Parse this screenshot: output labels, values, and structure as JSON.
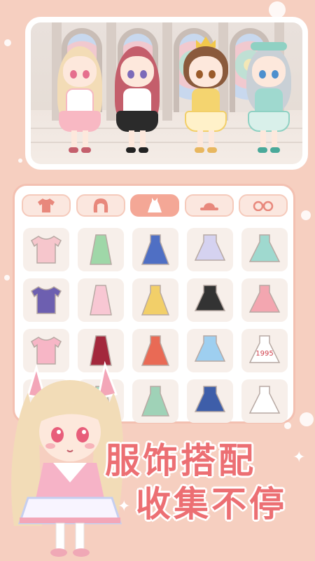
{
  "banner": {
    "scene_name": "cathedral-dressing-scene",
    "characters": [
      "blonde-girl",
      "red-hair-girl",
      "crown-girl",
      "silver-hair-girl"
    ]
  },
  "wardrobe": {
    "tabs": [
      {
        "name": "tops",
        "icon": "shirt-icon",
        "active": false
      },
      {
        "name": "hair",
        "icon": "hair-icon",
        "active": false
      },
      {
        "name": "dresses",
        "icon": "dress-icon",
        "active": true
      },
      {
        "name": "hats",
        "icon": "hat-icon",
        "active": false
      },
      {
        "name": "accessories",
        "icon": "glasses-icon",
        "active": false
      }
    ],
    "items": [
      {
        "icon": "pink-tshirt-icon",
        "color": "#f6c6cc"
      },
      {
        "icon": "green-robe-icon",
        "color": "#9fd7a8"
      },
      {
        "icon": "blue-dress-icon",
        "color": "#4f6fc4"
      },
      {
        "icon": "lavender-dress-icon",
        "color": "#d5d2f0"
      },
      {
        "icon": "mint-dress-icon",
        "color": "#9fd9cf"
      },
      {
        "icon": "purple-skirt-icon",
        "color": "#6d5fb0"
      },
      {
        "icon": "pink-frilly-dress-icon",
        "color": "#f8c7d3"
      },
      {
        "icon": "yellow-dress-icon",
        "color": "#f2cf69"
      },
      {
        "icon": "black-white-dress-icon",
        "color": "#333333"
      },
      {
        "icon": "pink-jacket-icon",
        "color": "#f3a6b0"
      },
      {
        "icon": "pink-long-coat-icon",
        "color": "#f7b6c6"
      },
      {
        "icon": "red-plaid-dress-icon",
        "color": "#a3283c"
      },
      {
        "icon": "red-hanfu-icon",
        "color": "#e96a55"
      },
      {
        "icon": "sailor-dress-icon",
        "color": "#9ecff0"
      },
      {
        "icon": "tshirt-print-icon",
        "color": "#ffffff",
        "text": "1995"
      },
      {
        "icon": "black-outfit-icon",
        "color": "#2e2e2e"
      },
      {
        "icon": "mint-dress-icon",
        "color": "#a8d8c2"
      },
      {
        "icon": "green-floral-dress-icon",
        "color": "#9fd2b7"
      },
      {
        "icon": "navy-blouse-icon",
        "color": "#3e5ea9"
      },
      {
        "icon": "white-socks-icon",
        "color": "#ffffff"
      }
    ]
  },
  "mascot": {
    "name": "cat-ear-girl"
  },
  "slogan": {
    "line1": "服饰搭配",
    "line2": "收集不停"
  },
  "colors": {
    "background": "#f6cfc0",
    "accent": "#ec6f73",
    "active_tab": "#f4a796"
  }
}
